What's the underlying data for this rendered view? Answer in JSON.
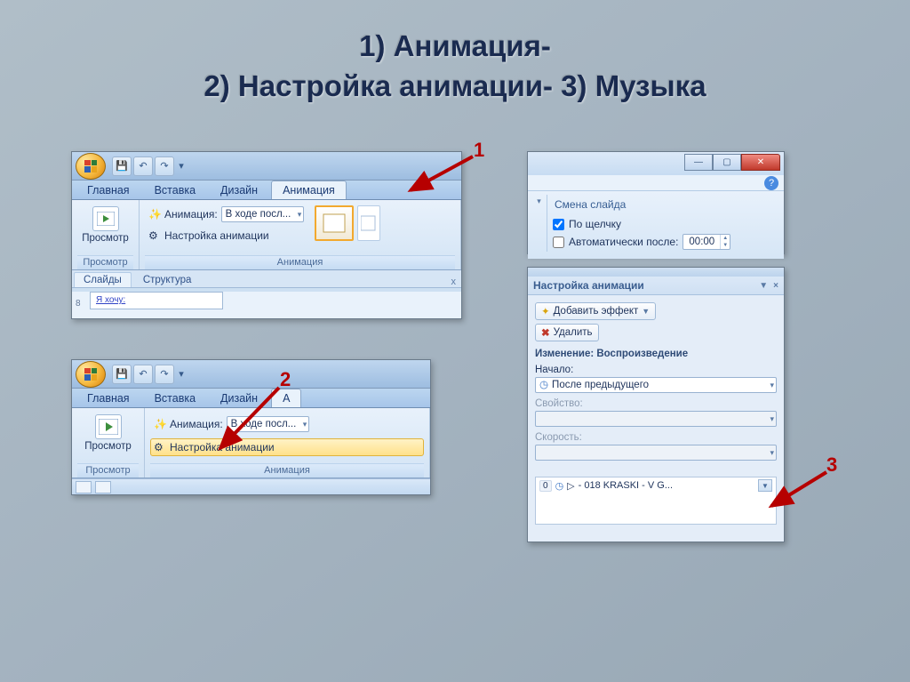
{
  "title_l1": "1) Анимация-",
  "title_l2": "2) Настройка анимации- 3) Музыка",
  "callout1": "1",
  "callout2": "2",
  "callout3": "3",
  "p1": {
    "tabs": [
      "Главная",
      "Вставка",
      "Дизайн",
      "Анимация"
    ],
    "active_tab": 3,
    "preview_label": "Просмотр",
    "preview_group": "Просмотр",
    "anim_label": "Анимация:",
    "anim_combo": "В ходе посл...",
    "custom_anim": "Настройка анимации",
    "anim_group": "Анимация",
    "subtabs": [
      "Слайды",
      "Структура"
    ],
    "slide_no": "8",
    "slide_text": "Я хочу:"
  },
  "p2": {
    "tabs": [
      "Главная",
      "Вставка",
      "Дизайн",
      "А"
    ],
    "preview_label": "Просмотр",
    "preview_group": "Просмотр",
    "anim_label": "Анимация:",
    "anim_combo": "В ходе посл...",
    "custom_anim": "Настройка анимации",
    "anim_group": "Анимация"
  },
  "trans": {
    "header": "Смена слайда",
    "onclick": "По щелчку",
    "auto_after": "Автоматически после:",
    "auto_time": "00:00"
  },
  "tp": {
    "title": "Настройка анимации",
    "add_effect": "Добавить эффект",
    "remove": "Удалить",
    "change_hdr": "Изменение: Воспроизведение",
    "start_lbl": "Начало:",
    "start_val": "После предыдущего",
    "prop_lbl": "Свойство:",
    "speed_lbl": "Скорость:",
    "eff_index": "0",
    "eff_name": "- 018 KRASKI - V G..."
  }
}
